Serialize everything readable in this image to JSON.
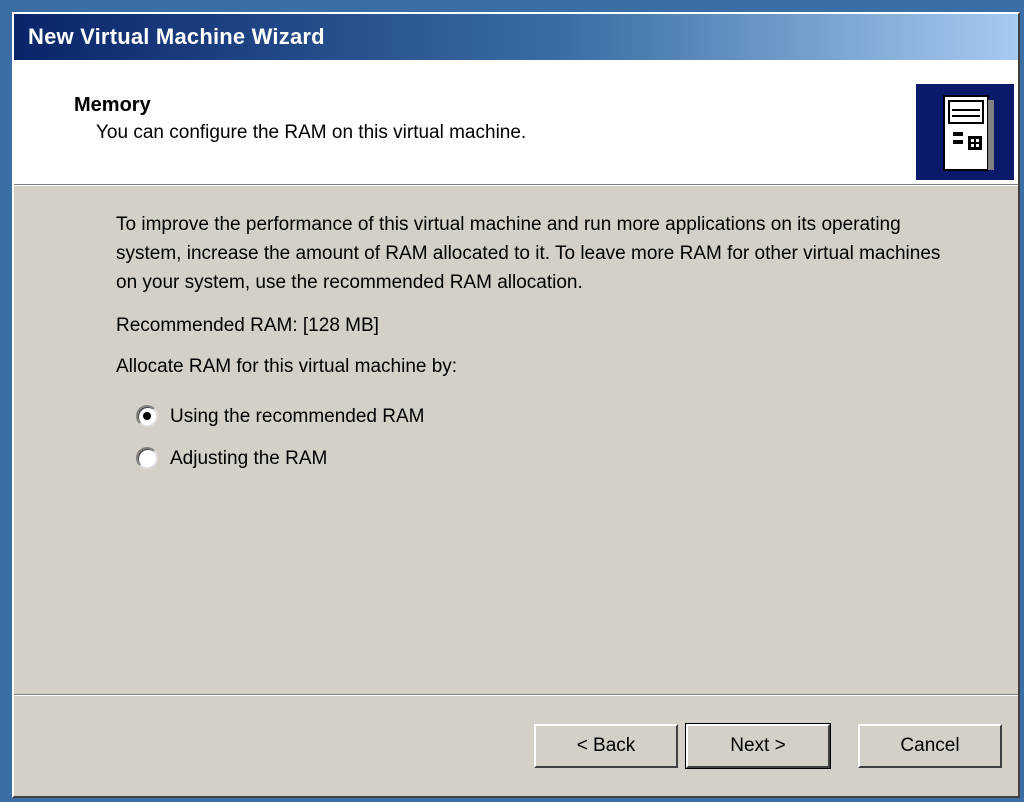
{
  "window": {
    "title": "New Virtual Machine Wizard"
  },
  "header": {
    "heading": "Memory",
    "subheading": "You can configure the RAM on this virtual machine.",
    "icon": "server-icon"
  },
  "content": {
    "intro": "To improve the performance of this virtual machine and run more applications on its operating system, increase the amount of RAM allocated to it. To leave more RAM for other virtual machines on your system, use the recommended RAM allocation.",
    "recommended": "Recommended RAM: [128 MB]",
    "allocate_label": "Allocate RAM for this virtual machine by:",
    "options": [
      {
        "label": "Using the recommended RAM",
        "checked": true
      },
      {
        "label": "Adjusting the RAM",
        "checked": false
      }
    ]
  },
  "buttons": {
    "back": "< Back",
    "next": "Next >",
    "cancel": "Cancel"
  },
  "colors": {
    "titlebar_start": "#0a246a",
    "titlebar_end": "#a6caf0",
    "dialog_bg": "#d4d0c8",
    "header_bg": "#ffffff"
  }
}
